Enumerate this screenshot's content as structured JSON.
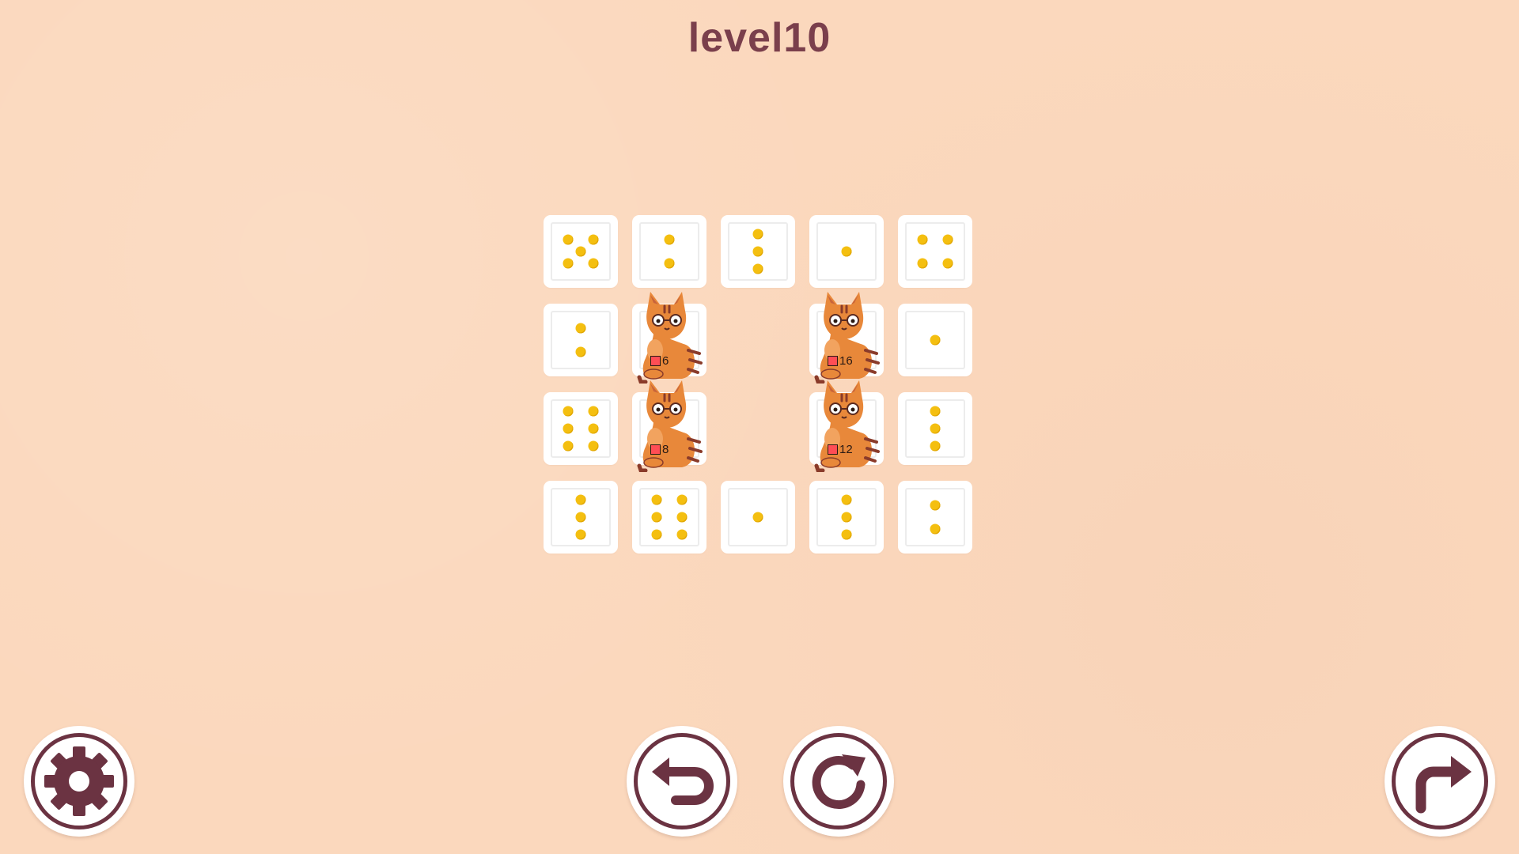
{
  "level": {
    "title": "level10"
  },
  "board": {
    "tiles": [
      {
        "id": "r0c0",
        "pips": 5
      },
      {
        "id": "r0c1",
        "pips": 2
      },
      {
        "id": "r0c2",
        "pips": 3
      },
      {
        "id": "r0c3",
        "pips": 1
      },
      {
        "id": "r0c4",
        "pips": 4
      },
      {
        "id": "r1c0",
        "pips": 2
      },
      {
        "id": "r1c1",
        "pips": 0
      },
      {
        "id": "r1c3",
        "pips": 0
      },
      {
        "id": "r1c4",
        "pips": 1
      },
      {
        "id": "r2c0",
        "pips": 6
      },
      {
        "id": "r2c1",
        "pips": 0
      },
      {
        "id": "r2c3",
        "pips": 0
      },
      {
        "id": "r2c4",
        "pips": 3
      },
      {
        "id": "r3c0",
        "pips": 3
      },
      {
        "id": "r3c1",
        "pips": 6
      },
      {
        "id": "r3c2",
        "pips": 1
      },
      {
        "id": "r3c3",
        "pips": 3
      },
      {
        "id": "r3c4",
        "pips": 2
      }
    ],
    "cats": [
      {
        "id": "cat-a",
        "count": "6"
      },
      {
        "id": "cat-b",
        "count": "8"
      },
      {
        "id": "cat-c",
        "count": "16"
      },
      {
        "id": "cat-d",
        "count": "12"
      }
    ]
  },
  "controls": {
    "settings_icon": "gear-icon",
    "undo_icon": "undo-arrow-icon",
    "restart_icon": "restart-icon",
    "skip_icon": "skip-forward-arrow-icon"
  },
  "colors": {
    "background": "#fbd8bd",
    "accent": "#6b3342",
    "title": "#7a3f4c",
    "pip": "#f4bf10",
    "cat": "#e8883a"
  }
}
